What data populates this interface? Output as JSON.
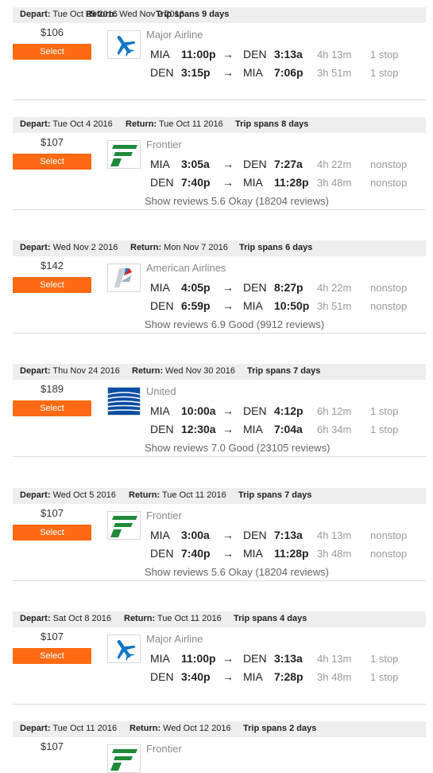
{
  "labels": {
    "depart": "Depart:",
    "return": "Return:",
    "select": "Select",
    "show_reviews": "Show reviews",
    "arrow": "→"
  },
  "colors": {
    "select_button": "#ff6a13",
    "header_bg": "#eeeeee",
    "frontier_green": "#1f8a3b",
    "major_blue": "#1276c5",
    "united_blue": "#0a4ea3"
  },
  "results": [
    {
      "depart": "Tue Oct 25 2016",
      "return": "Wed Nov 2 2016",
      "span": "Trip spans 9 days",
      "price": "$106",
      "airline": "Major Airline",
      "logo": "airplane-icon",
      "legs": [
        {
          "from": "MIA",
          "dep": "11:00p",
          "to": "DEN",
          "arr": "3:13a",
          "dur": "4h 13m",
          "stops": "1 stop"
        },
        {
          "from": "DEN",
          "dep": "3:15p",
          "to": "MIA",
          "arr": "7:06p",
          "dur": "3h 51m",
          "stops": "1 stop"
        }
      ],
      "reviews": ""
    },
    {
      "depart": "Tue Oct 4 2016",
      "return": "Tue Oct 11 2016",
      "span": "Trip spans 8 days",
      "price": "$107",
      "airline": "Frontier",
      "logo": "frontier-logo-icon",
      "legs": [
        {
          "from": "MIA",
          "dep": "3:05a",
          "to": "DEN",
          "arr": "7:27a",
          "dur": "4h 22m",
          "stops": "nonstop"
        },
        {
          "from": "DEN",
          "dep": "7:40p",
          "to": "MIA",
          "arr": "11:28p",
          "dur": "3h 48m",
          "stops": "nonstop"
        }
      ],
      "reviews": "5.6 Okay (18204 reviews)"
    },
    {
      "depart": "Wed Nov 2 2016",
      "return": "Mon Nov 7 2016",
      "span": "Trip spans 6 days",
      "price": "$142",
      "airline": "American Airlines",
      "logo": "american-logo-icon",
      "legs": [
        {
          "from": "MIA",
          "dep": "4:05p",
          "to": "DEN",
          "arr": "8:27p",
          "dur": "4h 22m",
          "stops": "nonstop"
        },
        {
          "from": "DEN",
          "dep": "6:59p",
          "to": "MIA",
          "arr": "10:50p",
          "dur": "3h 51m",
          "stops": "nonstop"
        }
      ],
      "reviews": "6.9 Good (9912 reviews)"
    },
    {
      "depart": "Thu Nov 24 2016",
      "return": "Wed Nov 30 2016",
      "span": "Trip spans 7 days",
      "price": "$189",
      "airline": "United",
      "logo": "united-globe-icon",
      "legs": [
        {
          "from": "MIA",
          "dep": "10:00a",
          "to": "DEN",
          "arr": "4:12p",
          "dur": "6h 12m",
          "stops": "1 stop"
        },
        {
          "from": "DEN",
          "dep": "12:30a",
          "to": "MIA",
          "arr": "7:04a",
          "dur": "6h 34m",
          "stops": "1 stop"
        }
      ],
      "reviews": "7.0 Good (23105 reviews)"
    },
    {
      "depart": "Wed Oct 5 2016",
      "return": "Tue Oct 11 2016",
      "span": "Trip spans 7 days",
      "price": "$107",
      "airline": "Frontier",
      "logo": "frontier-logo-icon",
      "legs": [
        {
          "from": "MIA",
          "dep": "3:00a",
          "to": "DEN",
          "arr": "7:13a",
          "dur": "4h 13m",
          "stops": "nonstop"
        },
        {
          "from": "DEN",
          "dep": "7:40p",
          "to": "MIA",
          "arr": "11:28p",
          "dur": "3h 48m",
          "stops": "nonstop"
        }
      ],
      "reviews": "5.6 Okay (18204 reviews)"
    },
    {
      "depart": "Sat Oct 8 2016",
      "return": "Tue Oct 11 2016",
      "span": "Trip spans 4 days",
      "price": "$107",
      "airline": "Major Airline",
      "logo": "airplane-icon",
      "legs": [
        {
          "from": "MIA",
          "dep": "11:00p",
          "to": "DEN",
          "arr": "3:13a",
          "dur": "4h 13m",
          "stops": "1 stop"
        },
        {
          "from": "DEN",
          "dep": "3:40p",
          "to": "MIA",
          "arr": "7:28p",
          "dur": "3h 48m",
          "stops": "1 stop"
        }
      ],
      "reviews": ""
    },
    {
      "depart": "Tue Oct 11 2016",
      "return": "Wed Oct 12 2016",
      "span": "Trip spans 2 days",
      "price": "$107",
      "airline": "Frontier",
      "logo": "frontier-logo-icon",
      "legs": [],
      "reviews": ""
    }
  ]
}
